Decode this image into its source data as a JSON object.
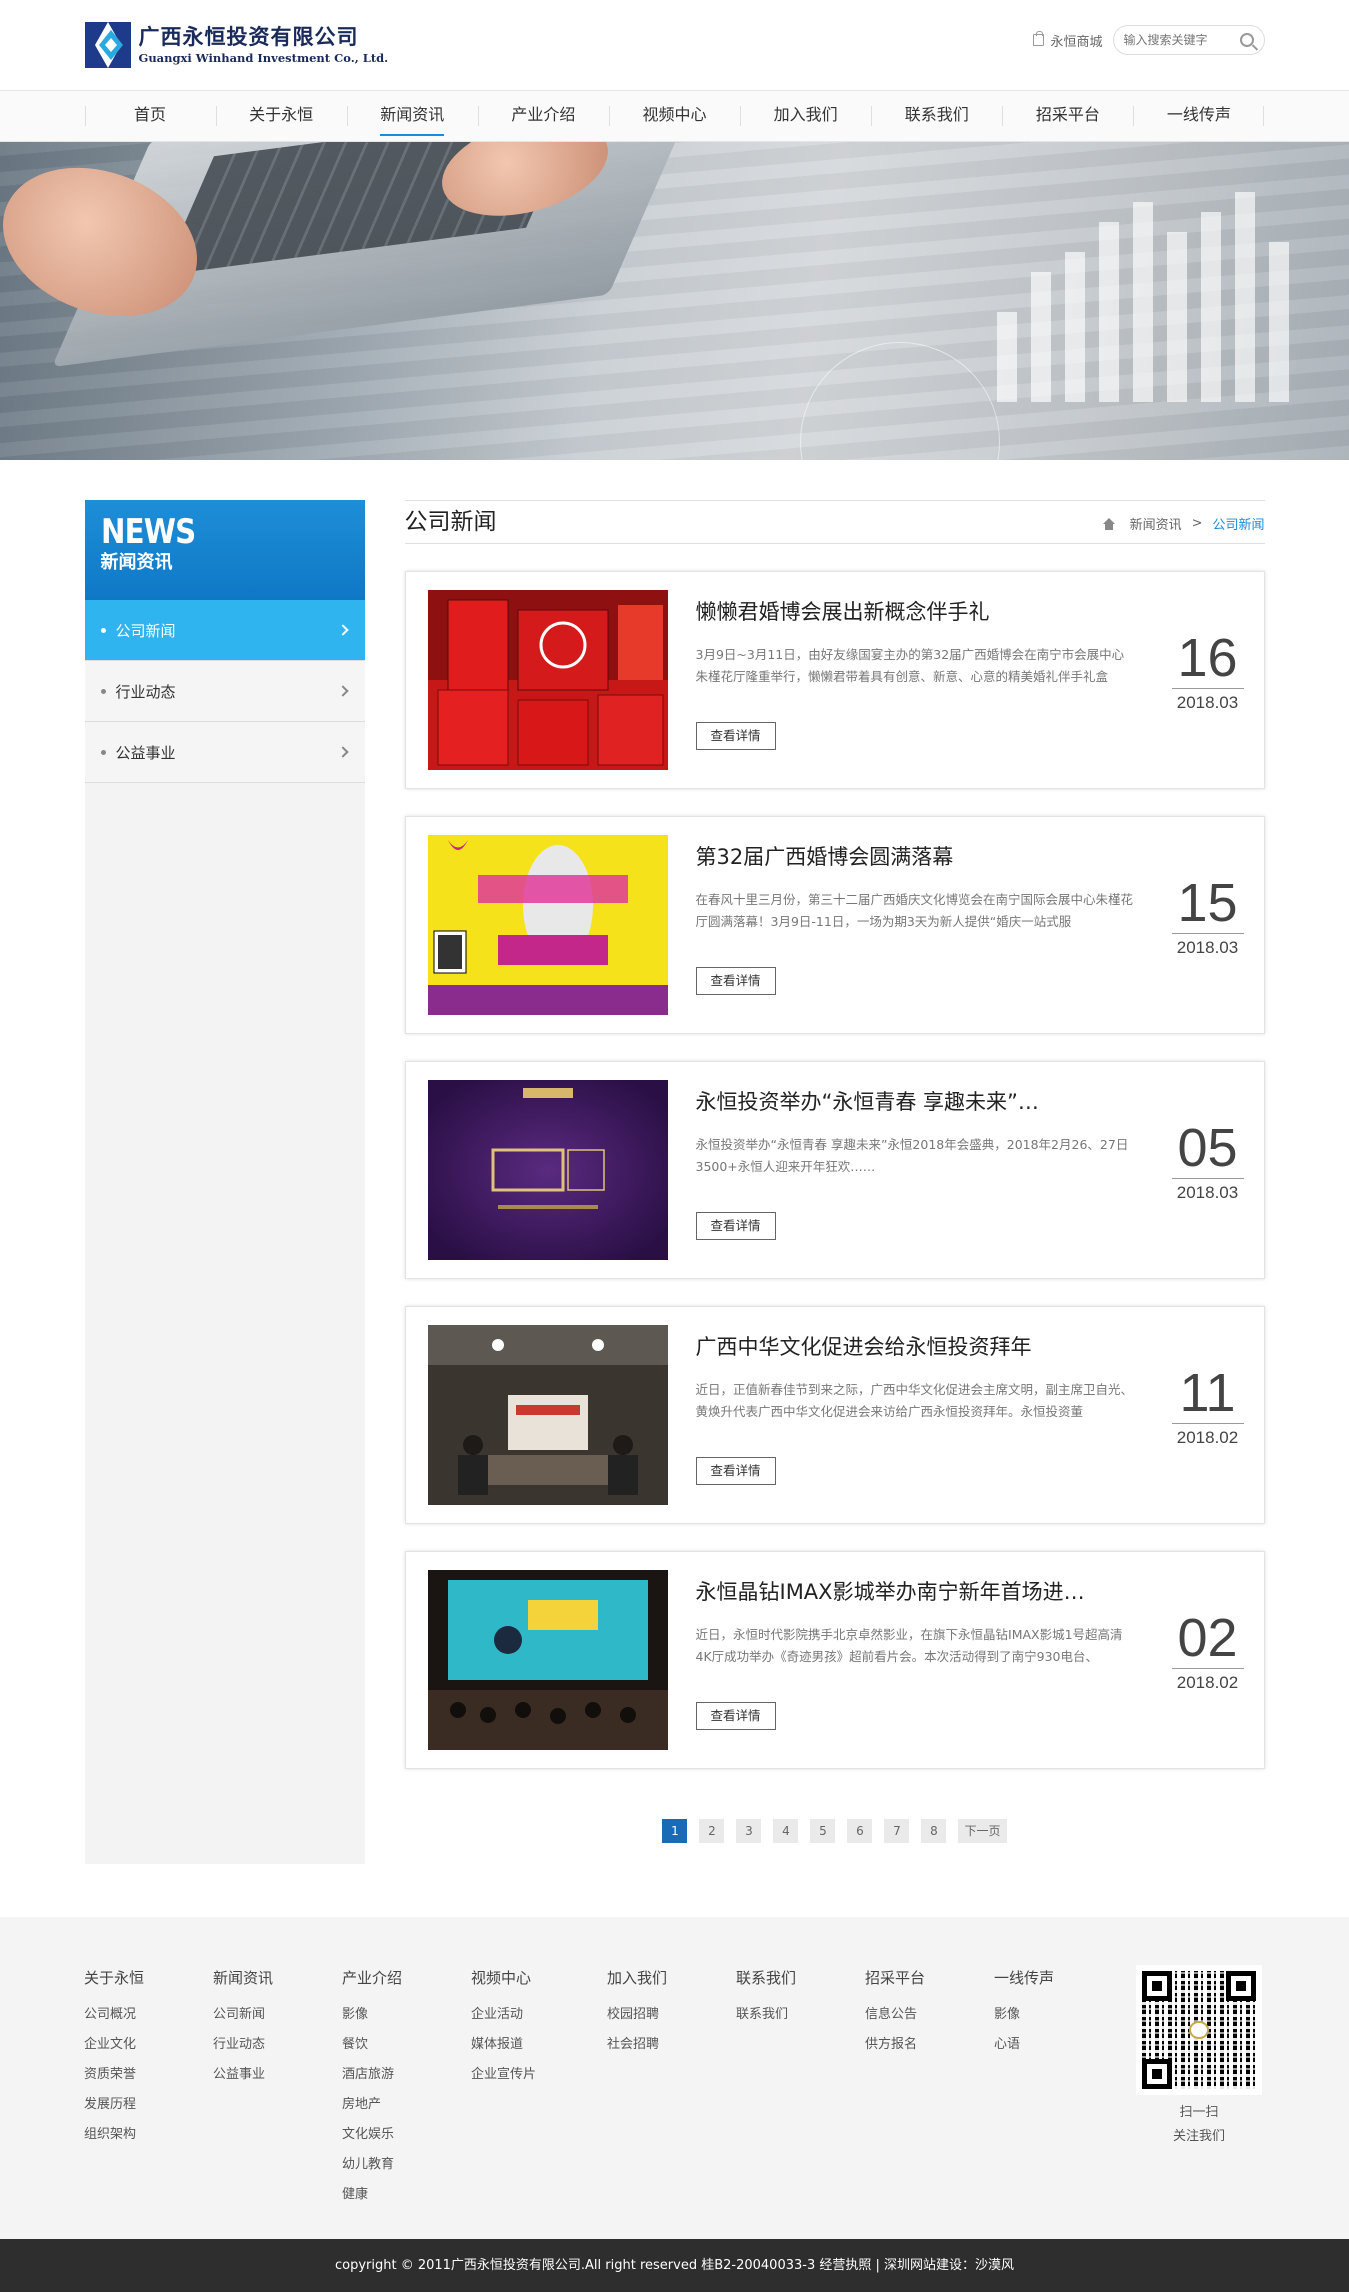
{
  "header": {
    "logo_cn": "广西永恒投资有限公司",
    "logo_en": "Guangxi Winhand Investment Co., Ltd.",
    "mall_label": "永恒商城",
    "search_placeholder": "输入搜索关键字"
  },
  "nav": {
    "items": [
      "首页",
      "关于永恒",
      "新闻资讯",
      "产业介绍",
      "视频中心",
      "加入我们",
      "联系我们",
      "招采平台",
      "一线传声"
    ],
    "active_index": 2
  },
  "sidebar": {
    "title_en": "NEWS",
    "title_cn": "新闻资讯",
    "items": [
      {
        "label": "公司新闻",
        "active": true
      },
      {
        "label": "行业动态",
        "active": false
      },
      {
        "label": "公益事业",
        "active": false
      }
    ]
  },
  "main": {
    "title": "公司新闻",
    "breadcrumb": {
      "parent": "新闻资讯",
      "separator": ">",
      "current": "公司新闻"
    },
    "more_label": "查看详情",
    "news": [
      {
        "title": "懒懒君婚博会展出新概念伴手礼",
        "summary": "3月9日~3月11日，由好友缘国宴主办的第32届广西婚博会在南宁市会展中心朱槿花厅隆重举行，懒懒君带着具有创意、新意、心意的精美婚礼伴手礼盒",
        "day": "16",
        "ym": "2018.03",
        "thumb": "red-gift-boxes"
      },
      {
        "title": "第32届广西婚博会圆满落幕",
        "summary": "在春风十里三月份，第三十二届广西婚庆文化博览会在南宁国际会展中心朱槿花厅圆满落幕！3月9日-11日，一场为期3天为新人提供“婚庆一站式服",
        "day": "15",
        "ym": "2018.03",
        "thumb": "wedding-expo-poster"
      },
      {
        "title": "永恒投资举办“永恒青春 享趣未来”…",
        "summary": "永恒投资举办“永恒青春 享趣未来”永恒2018年会盛典，2018年2月26、27日3500+永恒人迎来开年狂欢……",
        "day": "05",
        "ym": "2018.03",
        "thumb": "annual-party-2018"
      },
      {
        "title": "广西中华文化促进会给永恒投资拜年",
        "summary": "近日，正值新春佳节到来之际，广西中华文化促进会主席文明，副主席卫自光、黄焕升代表广西中华文化促进会来访给广西永恒投资拜年。永恒投资董",
        "day": "11",
        "ym": "2018.02",
        "thumb": "meeting-room"
      },
      {
        "title": "永恒晶钻IMAX影城举办南宁新年首场进…",
        "summary": "近日，永恒时代影院携手北京卓然影业，在旗下永恒晶钻IMAX影城1号超高清4K厅成功举办《奇迹男孩》超前看片会。本次活动得到了南宁930电台、",
        "day": "02",
        "ym": "2018.02",
        "thumb": "cinema-screening"
      }
    ],
    "pager": {
      "pages": [
        "1",
        "2",
        "3",
        "4",
        "5",
        "6",
        "7",
        "8"
      ],
      "current": "1",
      "next": "下一页"
    }
  },
  "footer": {
    "columns": [
      {
        "title": "关于永恒",
        "links": [
          "公司概况",
          "企业文化",
          "资质荣誉",
          "发展历程",
          "组织架构"
        ]
      },
      {
        "title": "新闻资讯",
        "links": [
          "公司新闻",
          "行业动态",
          "公益事业"
        ]
      },
      {
        "title": "产业介绍",
        "links": [
          "影像",
          "餐饮",
          "酒店旅游",
          "房地产",
          "文化娱乐",
          "幼儿教育",
          "健康"
        ]
      },
      {
        "title": "视频中心",
        "links": [
          "企业活动",
          "媒体报道",
          "企业宣传片"
        ]
      },
      {
        "title": "加入我们",
        "links": [
          "校园招聘",
          "社会招聘"
        ]
      },
      {
        "title": "联系我们",
        "links": [
          "联系我们"
        ]
      },
      {
        "title": "招采平台",
        "links": [
          "信息公告",
          "供方报名"
        ]
      },
      {
        "title": "一线传声",
        "links": [
          "影像",
          "心语"
        ]
      }
    ],
    "qr_line1": "扫一扫",
    "qr_line2": "关注我们",
    "copyright": "copyright © 2011广西永恒投资有限公司.All right reserved   桂B2-20040033-3   经营执照   |   深圳网站建设：沙漠风"
  },
  "colors": {
    "accent": "#1a8cd8",
    "sidebar_active": "#2fb4f0",
    "pager_active": "#1a6bb5",
    "footer_bar": "#2e2e2e"
  }
}
